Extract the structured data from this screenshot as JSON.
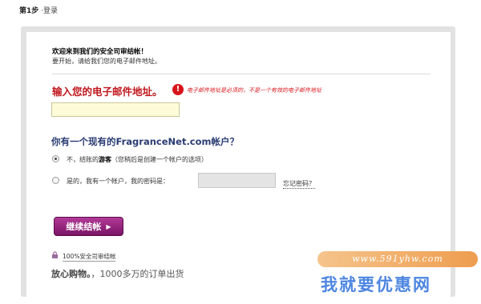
{
  "header": {
    "step_number": "第1步",
    "step_name": "登录"
  },
  "welcome": {
    "title": "欢迎来到我们的安全司审结帐！",
    "subtitle": "要开始，请给我们您的电子邮件地址。"
  },
  "email": {
    "label": "输入您的电子邮件地址。",
    "error_message": "电子邮件地址是必须的，不是一个有效的电子邮件地址",
    "value": ""
  },
  "account": {
    "question": "你有一个现有的FragranceNet.com帐户？",
    "guest_option_prefix": "不，结账的",
    "guest_option_bold": "游客",
    "guest_option_suffix": "（您稍后是创建一个帐户的选项）",
    "member_option": "是的，我有一个帐户，我的密码是：",
    "forgot_password": "忘记密码？",
    "selected": "guest"
  },
  "continue_button": {
    "label": "继续结帐"
  },
  "footer": {
    "secure_text": "100%安全司审结帐",
    "shop_bold": "放心购物。",
    "shop_rest": "，1000多万的订单出货"
  },
  "watermark": {
    "url": "www.591yhw.com",
    "name": "我就要优惠网"
  },
  "colors": {
    "error_red": "#d8141b",
    "question_navy": "#2a3c73",
    "button_purple": "#8e1f78",
    "email_input_bg": "#fefcd8"
  },
  "icons": [
    "error-icon",
    "arrow-right-icon",
    "lock-icon"
  ]
}
